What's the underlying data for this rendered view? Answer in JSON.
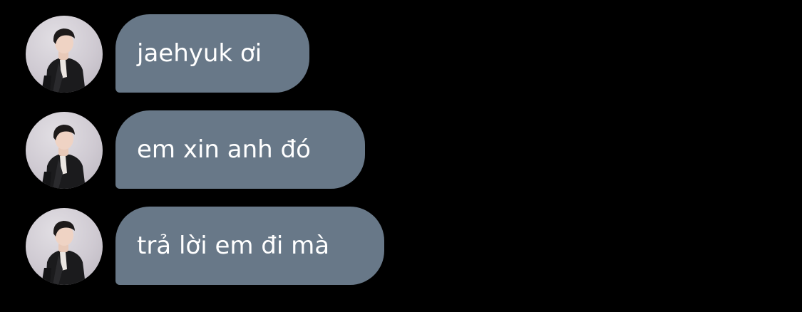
{
  "conversation": {
    "messages": [
      {
        "text": "jaehyuk ơi",
        "avatar_icon": "profile-photo"
      },
      {
        "text": "em xin anh đó",
        "avatar_icon": "profile-photo"
      },
      {
        "text": "trả lời em đi mà",
        "avatar_icon": "profile-photo"
      }
    ]
  },
  "colors": {
    "background": "#000000",
    "bubble": "#687888",
    "bubble_text": "#ffffff"
  }
}
